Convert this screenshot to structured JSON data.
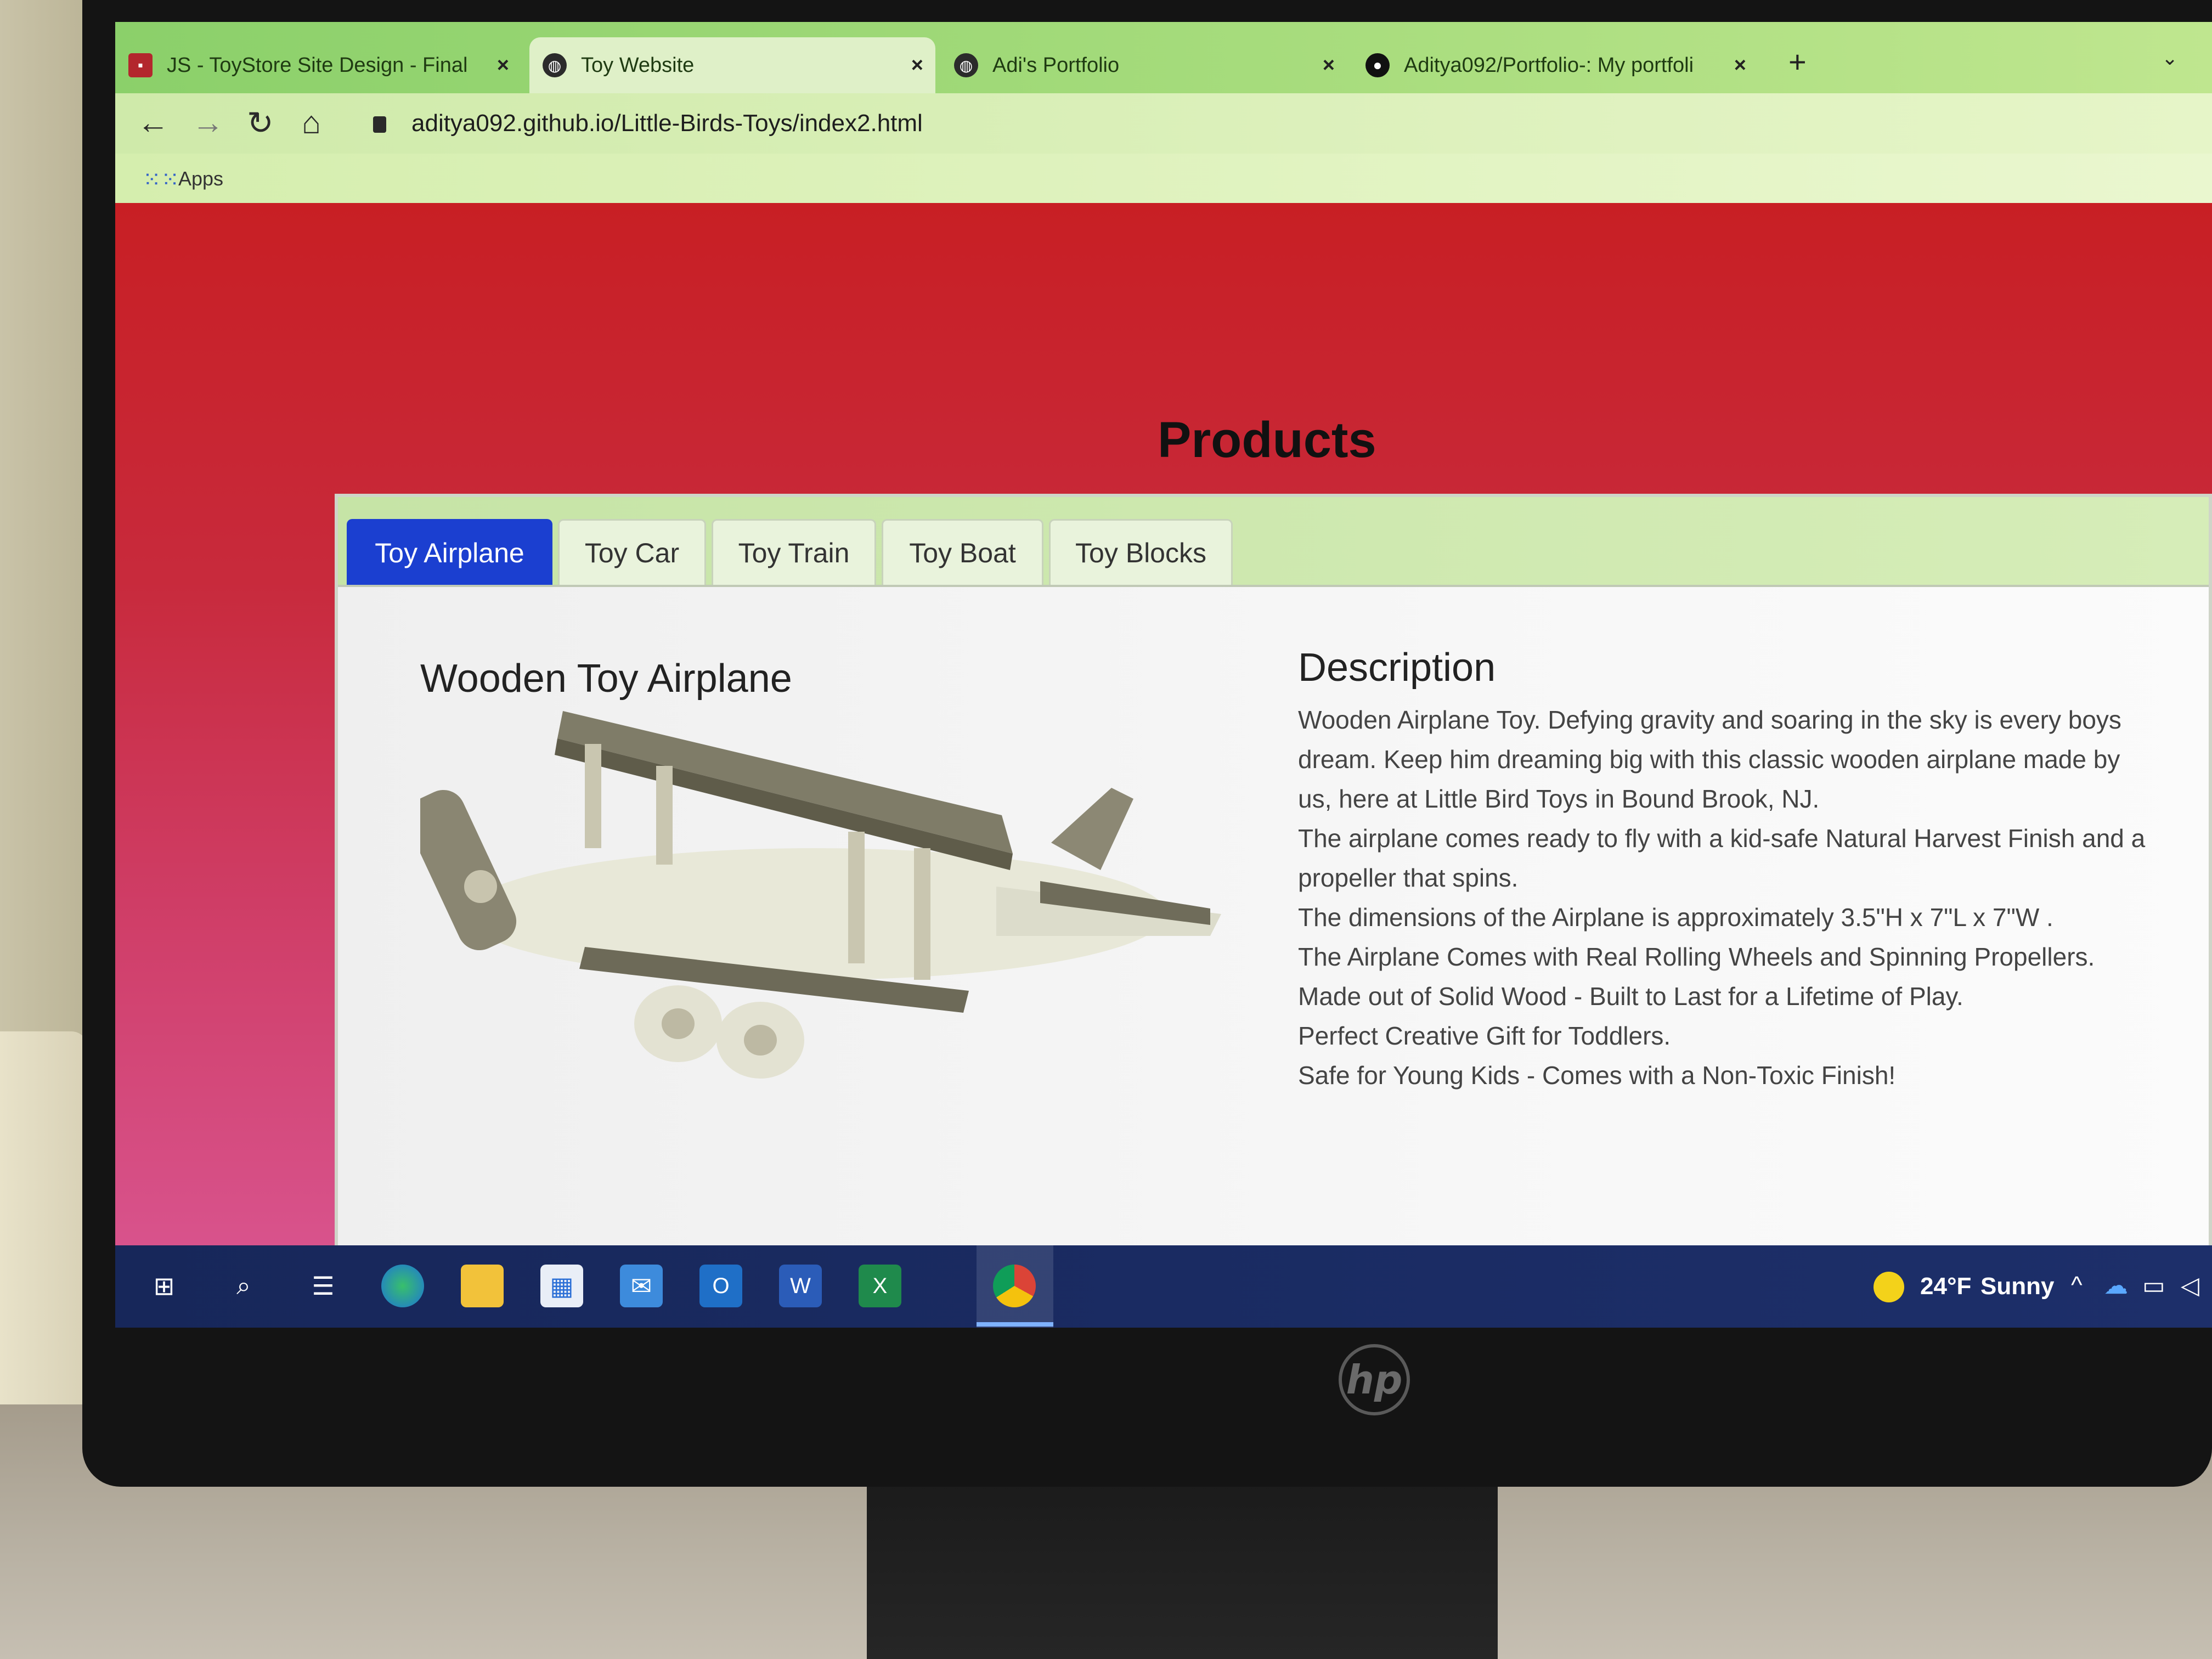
{
  "browser": {
    "tabs": [
      {
        "label": "JS - ToyStore Site Design - Final S",
        "icon": "document-icon",
        "active": false
      },
      {
        "label": "Toy Website",
        "icon": "globe-icon",
        "active": true
      },
      {
        "label": "Adi's Portfolio",
        "icon": "globe-icon",
        "active": false
      },
      {
        "label": "Aditya092/Portfolio-: My portfoli",
        "icon": "github-icon",
        "active": false
      }
    ],
    "new_tab": "+",
    "close_glyph": "×",
    "url": "aditya092.github.io/Little-Birds-Toys/index2.html",
    "bookmarks": {
      "apps_label": "Apps"
    }
  },
  "page": {
    "title": "Products",
    "product_tabs": [
      {
        "label": "Toy Airplane",
        "active": true
      },
      {
        "label": "Toy Car",
        "active": false
      },
      {
        "label": "Toy Train",
        "active": false
      },
      {
        "label": "Toy Boat",
        "active": false
      },
      {
        "label": "Toy Blocks",
        "active": false
      }
    ],
    "product": {
      "name": "Wooden Toy Airplane",
      "description_title": "Description",
      "description": [
        "Wooden Airplane Toy. Defying gravity and soaring in the sky is every boys dream. Keep him dreaming big with this classic wooden airplane made by us, here at Little Bird Toys in Bound Brook, NJ.",
        "The airplane comes ready to fly with a kid-safe Natural Harvest Finish and a propeller that spins.",
        "The dimensions of the Airplane is approximately 3.5\"H x 7\"L x 7\"W .",
        "The Airplane Comes with Real Rolling Wheels and Spinning Propellers.",
        "Made out of Solid Wood - Built to Last for a Lifetime of Play.",
        "Perfect Creative Gift for Toddlers.",
        "Safe for Young Kids - Comes with a Non-Toxic Finish!"
      ]
    }
  },
  "taskbar": {
    "weather": {
      "temp": "24°F",
      "condition": "Sunny"
    }
  },
  "monitor": {
    "brand": "hp"
  },
  "colors": {
    "page_gradient_top": "#c81f24",
    "page_gradient_bottom": "#d95590",
    "active_tab": "#1b3fd0",
    "browser_theme": "#a9dd7e",
    "taskbar": "#1d2f6a"
  }
}
